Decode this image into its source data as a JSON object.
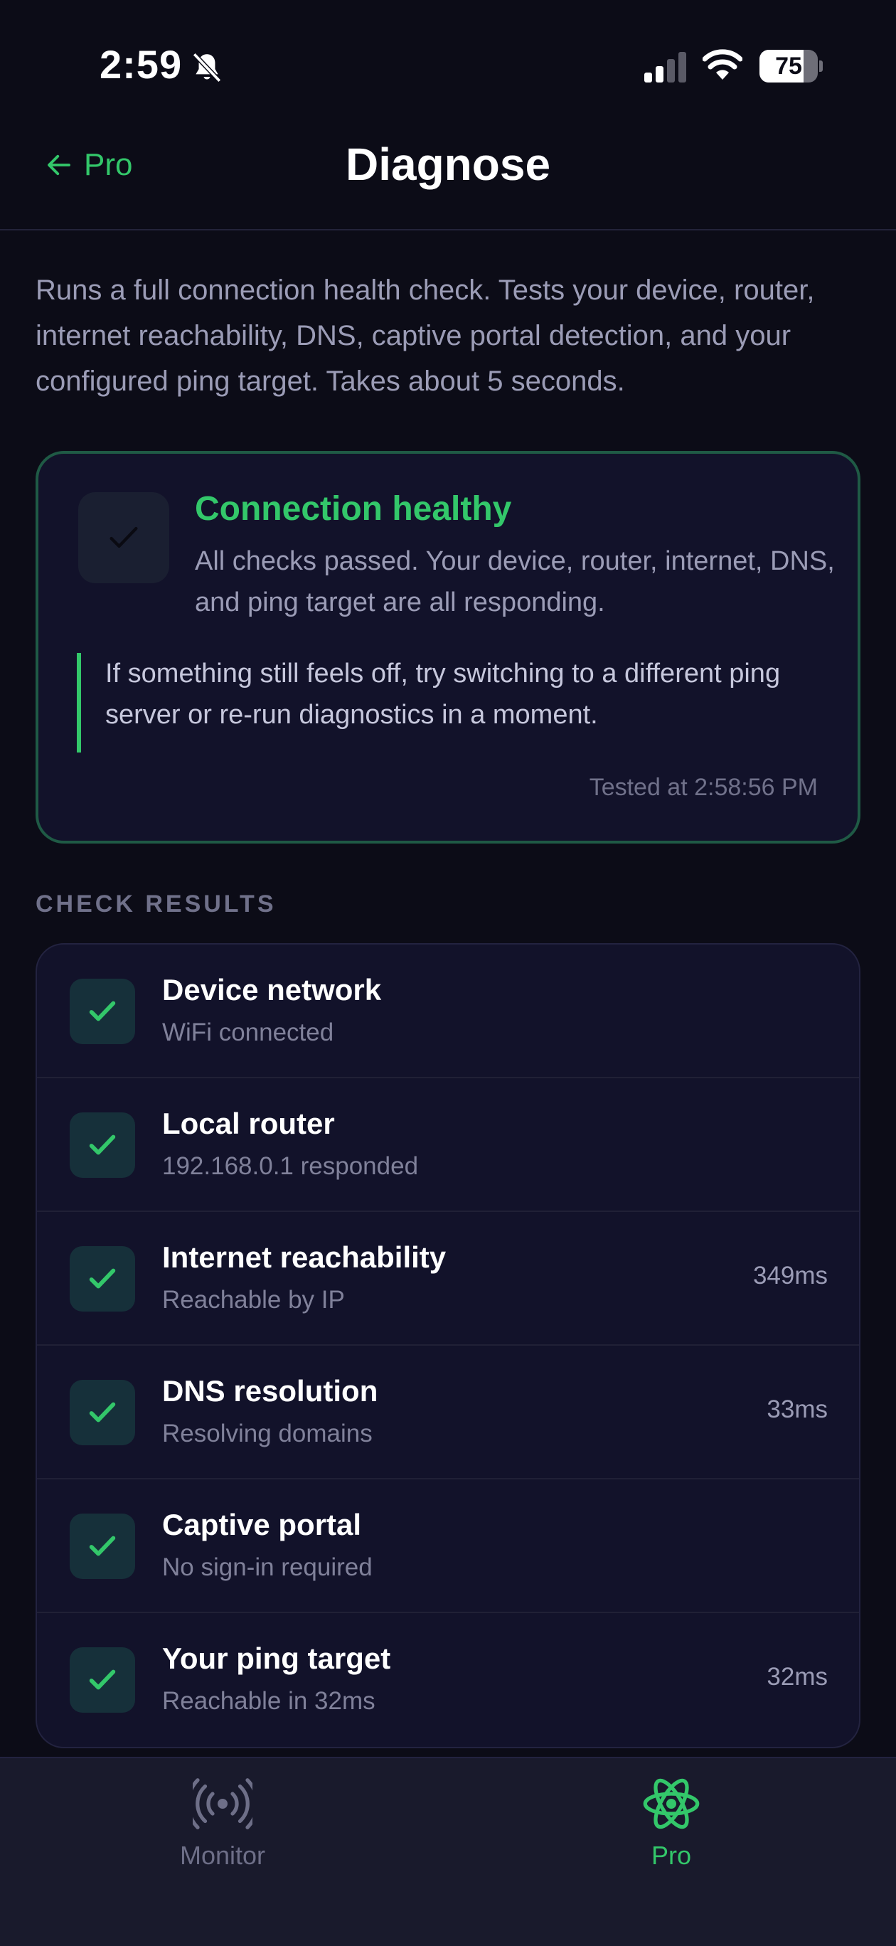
{
  "status_bar": {
    "time": "2:59",
    "battery_percent": "75",
    "battery_level": 0.75
  },
  "header": {
    "back_label": "Pro",
    "title": "Diagnose"
  },
  "description": "Runs a full connection health check. Tests your device, router, internet reachability, DNS, captive portal detection, and your configured ping target. Takes about 5 seconds.",
  "health": {
    "title": "Connection healthy",
    "subtitle": "All checks passed. Your device, router, internet, DNS, and ping target are all responding.",
    "note": "If something still feels off, try switching to a different ping server or re-run diagnostics in a moment.",
    "tested_at": "Tested at 2:58:56 PM"
  },
  "section_label": "CHECK RESULTS",
  "results": [
    {
      "title": "Device network",
      "sub": "WiFi connected",
      "ms": ""
    },
    {
      "title": "Local router",
      "sub": "192.168.0.1 responded",
      "ms": ""
    },
    {
      "title": "Internet reachability",
      "sub": "Reachable by IP",
      "ms": "349ms"
    },
    {
      "title": "DNS resolution",
      "sub": "Resolving domains",
      "ms": "33ms"
    },
    {
      "title": "Captive portal",
      "sub": "No sign-in required",
      "ms": ""
    },
    {
      "title": "Your ping target",
      "sub": "Reachable in 32ms",
      "ms": "32ms"
    }
  ],
  "tabs": {
    "monitor": "Monitor",
    "pro": "Pro"
  },
  "colors": {
    "accent": "#33c76a",
    "background": "#0c0c17",
    "card": "#12122a"
  },
  "icons": {
    "back": "arrow-left-icon",
    "bell": "bell-slash-icon",
    "check": "checkmark-icon",
    "monitor": "broadcast-icon",
    "pro": "atom-icon"
  }
}
